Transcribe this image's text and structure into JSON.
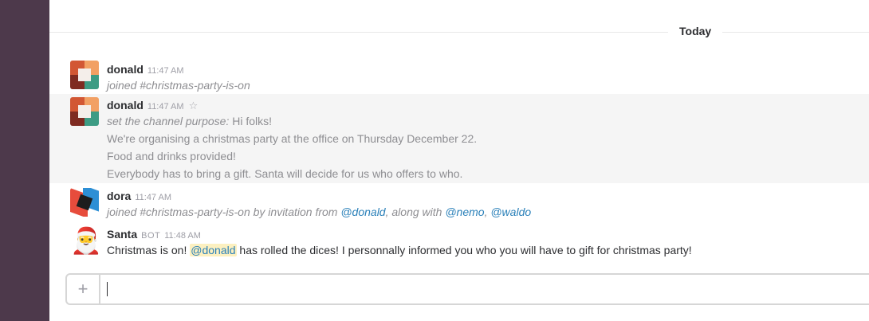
{
  "day_divider": "Today",
  "messages": [
    {
      "sender": "donald",
      "time": "11:47 AM",
      "text": "joined #christmas-party-is-on"
    },
    {
      "sender": "donald",
      "time": "11:47 AM",
      "star_icon": "star-icon",
      "purpose_prefix": "set the channel purpose:",
      "purpose_first": "Hi folks!",
      "lines": [
        "We're organising a christmas party at the office on Thursday December 22.",
        "Food and drinks provided!",
        "Everybody has to bring a gift. Santa will decide for us who offers to who."
      ]
    },
    {
      "sender": "dora",
      "time": "11:47 AM",
      "text_prefix": "joined #christmas-party-is-on by invitation from",
      "mention1": "@donald",
      "text_mid": ", along with",
      "mention2": "@nemo",
      "text_sep": ",",
      "mention3": "@waldo"
    },
    {
      "sender": "Santa",
      "bot_badge": "BOT",
      "time": "11:48 AM",
      "text_before": "Christmas is on!",
      "mention": "@donald",
      "text_after": "has rolled the dices! I personnally informed you who you will have to gift for christmas party!"
    }
  ],
  "composer": {
    "plus_icon": "+",
    "placeholder": ""
  },
  "colors": {
    "sidebar": "#4d394b",
    "mention": "#2a80b9",
    "mention_highlight": "#fcf0c0"
  }
}
